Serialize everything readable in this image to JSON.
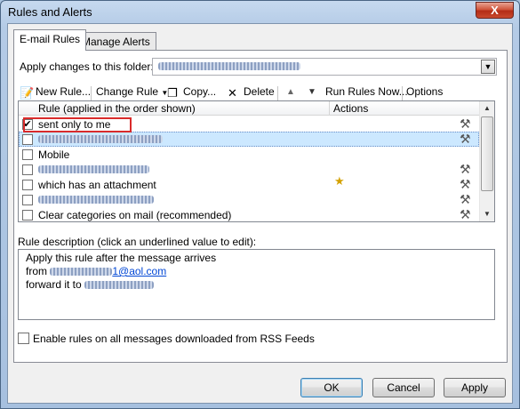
{
  "window": {
    "title": "Rules and Alerts",
    "close_label": "X"
  },
  "tabs": [
    {
      "label": "E-mail Rules"
    },
    {
      "label": "Manage Alerts"
    }
  ],
  "folder": {
    "label": "Apply changes to this folder:",
    "dropdown_icon": "▼"
  },
  "toolbar": {
    "new_rule": "New Rule...",
    "change_rule": "Change Rule",
    "copy": "Copy...",
    "delete": "Delete",
    "run_rules": "Run Rules Now...",
    "options": "Options",
    "icons": {
      "new": "new-rule-icon",
      "copy": "copy-icon",
      "delete": "delete-x-icon",
      "up": "move-up-icon",
      "down": "move-down-icon"
    }
  },
  "rules_table": {
    "columns": [
      "Rule (applied in the order shown)",
      "Actions"
    ],
    "rows": [
      {
        "checked": true,
        "label": "sent only to me",
        "selected": false
      },
      {
        "checked": false,
        "label": "",
        "selected": true
      },
      {
        "checked": false,
        "label": "Mobile",
        "selected": false
      },
      {
        "checked": false,
        "label": "",
        "selected": false
      },
      {
        "checked": false,
        "label": "which has an attachment",
        "selected": false
      },
      {
        "checked": false,
        "label": "",
        "selected": false
      },
      {
        "checked": false,
        "label": "Clear categories on mail (recommended)",
        "selected": false
      }
    ]
  },
  "description": {
    "label": "Rule description (click an underlined value to edit):",
    "line1": "Apply this rule after the message arrives",
    "line2_prefix": "from",
    "line2_link_suffix": "1@aol.com",
    "line3_prefix": "forward it to"
  },
  "rss": {
    "label": "Enable rules on all messages downloaded from RSS Feeds"
  },
  "buttons": {
    "ok": "OK",
    "cancel": "Cancel",
    "apply": "Apply"
  },
  "colors": {
    "selection": "#cce8ff",
    "highlight": "#d92b2b",
    "link": "#0046d5"
  }
}
